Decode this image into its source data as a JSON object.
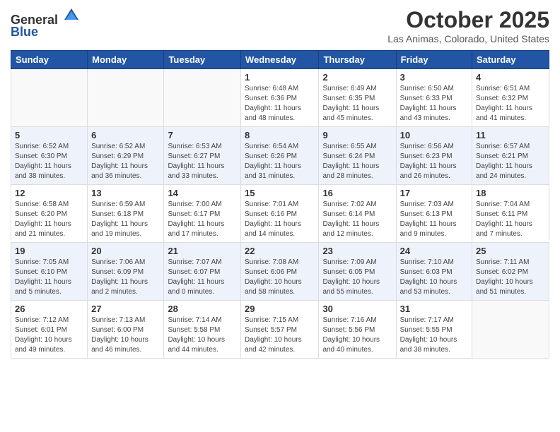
{
  "header": {
    "logo_general": "General",
    "logo_blue": "Blue",
    "month_year": "October 2025",
    "location": "Las Animas, Colorado, United States"
  },
  "weekdays": [
    "Sunday",
    "Monday",
    "Tuesday",
    "Wednesday",
    "Thursday",
    "Friday",
    "Saturday"
  ],
  "weeks": [
    [
      {
        "day": "",
        "info": ""
      },
      {
        "day": "",
        "info": ""
      },
      {
        "day": "",
        "info": ""
      },
      {
        "day": "1",
        "info": "Sunrise: 6:48 AM\nSunset: 6:36 PM\nDaylight: 11 hours\nand 48 minutes."
      },
      {
        "day": "2",
        "info": "Sunrise: 6:49 AM\nSunset: 6:35 PM\nDaylight: 11 hours\nand 45 minutes."
      },
      {
        "day": "3",
        "info": "Sunrise: 6:50 AM\nSunset: 6:33 PM\nDaylight: 11 hours\nand 43 minutes."
      },
      {
        "day": "4",
        "info": "Sunrise: 6:51 AM\nSunset: 6:32 PM\nDaylight: 11 hours\nand 41 minutes."
      }
    ],
    [
      {
        "day": "5",
        "info": "Sunrise: 6:52 AM\nSunset: 6:30 PM\nDaylight: 11 hours\nand 38 minutes."
      },
      {
        "day": "6",
        "info": "Sunrise: 6:52 AM\nSunset: 6:29 PM\nDaylight: 11 hours\nand 36 minutes."
      },
      {
        "day": "7",
        "info": "Sunrise: 6:53 AM\nSunset: 6:27 PM\nDaylight: 11 hours\nand 33 minutes."
      },
      {
        "day": "8",
        "info": "Sunrise: 6:54 AM\nSunset: 6:26 PM\nDaylight: 11 hours\nand 31 minutes."
      },
      {
        "day": "9",
        "info": "Sunrise: 6:55 AM\nSunset: 6:24 PM\nDaylight: 11 hours\nand 28 minutes."
      },
      {
        "day": "10",
        "info": "Sunrise: 6:56 AM\nSunset: 6:23 PM\nDaylight: 11 hours\nand 26 minutes."
      },
      {
        "day": "11",
        "info": "Sunrise: 6:57 AM\nSunset: 6:21 PM\nDaylight: 11 hours\nand 24 minutes."
      }
    ],
    [
      {
        "day": "12",
        "info": "Sunrise: 6:58 AM\nSunset: 6:20 PM\nDaylight: 11 hours\nand 21 minutes."
      },
      {
        "day": "13",
        "info": "Sunrise: 6:59 AM\nSunset: 6:18 PM\nDaylight: 11 hours\nand 19 minutes."
      },
      {
        "day": "14",
        "info": "Sunrise: 7:00 AM\nSunset: 6:17 PM\nDaylight: 11 hours\nand 17 minutes."
      },
      {
        "day": "15",
        "info": "Sunrise: 7:01 AM\nSunset: 6:16 PM\nDaylight: 11 hours\nand 14 minutes."
      },
      {
        "day": "16",
        "info": "Sunrise: 7:02 AM\nSunset: 6:14 PM\nDaylight: 11 hours\nand 12 minutes."
      },
      {
        "day": "17",
        "info": "Sunrise: 7:03 AM\nSunset: 6:13 PM\nDaylight: 11 hours\nand 9 minutes."
      },
      {
        "day": "18",
        "info": "Sunrise: 7:04 AM\nSunset: 6:11 PM\nDaylight: 11 hours\nand 7 minutes."
      }
    ],
    [
      {
        "day": "19",
        "info": "Sunrise: 7:05 AM\nSunset: 6:10 PM\nDaylight: 11 hours\nand 5 minutes."
      },
      {
        "day": "20",
        "info": "Sunrise: 7:06 AM\nSunset: 6:09 PM\nDaylight: 11 hours\nand 2 minutes."
      },
      {
        "day": "21",
        "info": "Sunrise: 7:07 AM\nSunset: 6:07 PM\nDaylight: 11 hours\nand 0 minutes."
      },
      {
        "day": "22",
        "info": "Sunrise: 7:08 AM\nSunset: 6:06 PM\nDaylight: 10 hours\nand 58 minutes."
      },
      {
        "day": "23",
        "info": "Sunrise: 7:09 AM\nSunset: 6:05 PM\nDaylight: 10 hours\nand 55 minutes."
      },
      {
        "day": "24",
        "info": "Sunrise: 7:10 AM\nSunset: 6:03 PM\nDaylight: 10 hours\nand 53 minutes."
      },
      {
        "day": "25",
        "info": "Sunrise: 7:11 AM\nSunset: 6:02 PM\nDaylight: 10 hours\nand 51 minutes."
      }
    ],
    [
      {
        "day": "26",
        "info": "Sunrise: 7:12 AM\nSunset: 6:01 PM\nDaylight: 10 hours\nand 49 minutes."
      },
      {
        "day": "27",
        "info": "Sunrise: 7:13 AM\nSunset: 6:00 PM\nDaylight: 10 hours\nand 46 minutes."
      },
      {
        "day": "28",
        "info": "Sunrise: 7:14 AM\nSunset: 5:58 PM\nDaylight: 10 hours\nand 44 minutes."
      },
      {
        "day": "29",
        "info": "Sunrise: 7:15 AM\nSunset: 5:57 PM\nDaylight: 10 hours\nand 42 minutes."
      },
      {
        "day": "30",
        "info": "Sunrise: 7:16 AM\nSunset: 5:56 PM\nDaylight: 10 hours\nand 40 minutes."
      },
      {
        "day": "31",
        "info": "Sunrise: 7:17 AM\nSunset: 5:55 PM\nDaylight: 10 hours\nand 38 minutes."
      },
      {
        "day": "",
        "info": ""
      }
    ]
  ]
}
